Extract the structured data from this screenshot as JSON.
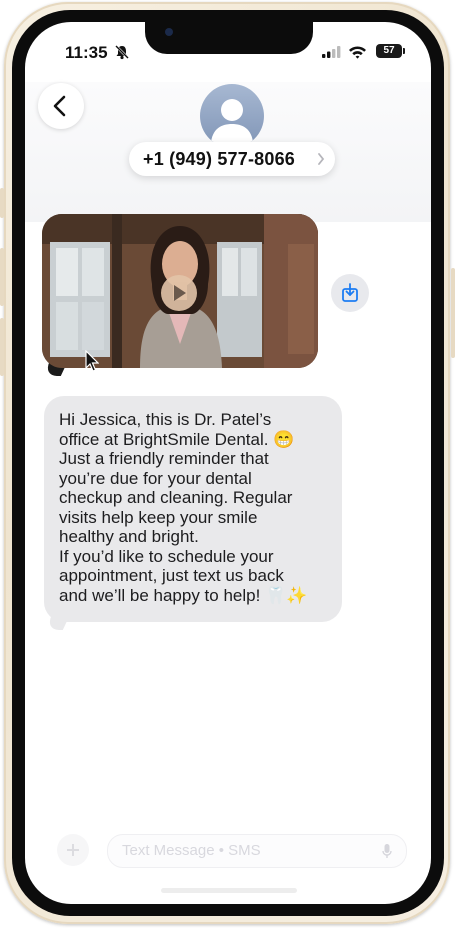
{
  "status_bar": {
    "time": "11:35",
    "battery": "57",
    "silent_icon": "bell-slash-icon",
    "signal_icon": "cellular-signal-icon",
    "wifi_icon": "wifi-icon"
  },
  "header": {
    "back_icon": "chevron-left-icon",
    "avatar_icon": "person-silhouette-icon",
    "contact": "+1 (949) 577-8066",
    "chevron_icon": "chevron-right-icon"
  },
  "messages": [
    {
      "type": "video",
      "play_icon": "play-icon",
      "save_icon": "download-icon"
    },
    {
      "type": "text",
      "lines": [
        "Hi Jessica, this is Dr. Patel’s",
        "office at BrightSmile Dental. 😁",
        "Just a friendly reminder that",
        "you’re due for your dental",
        "checkup and cleaning. Regular",
        "visits help keep your smile",
        "healthy and bright.",
        "If you’d like to schedule your",
        "appointment, just text us back",
        "and we’ll be happy to help! 🦷✨"
      ]
    }
  ],
  "input": {
    "placeholder": "Text Message • SMS",
    "plus_icon": "plus-icon",
    "mic_icon": "microphone-icon"
  },
  "colors": {
    "bubble_gray": "#e9e9eb",
    "accent_blue": "#1d7df2",
    "frame": "#efe4cf"
  }
}
